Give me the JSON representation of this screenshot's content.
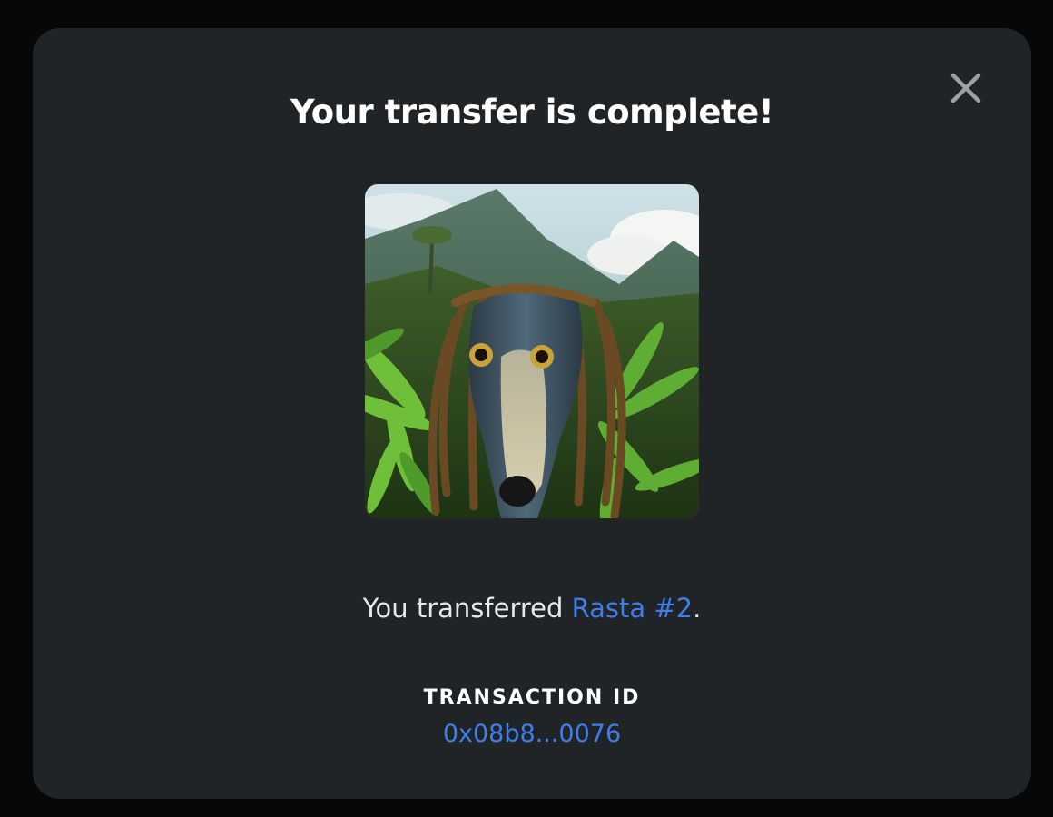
{
  "modal": {
    "title": "Your transfer is complete!",
    "close_icon": "close-icon"
  },
  "nft": {
    "image_subject": "dog-with-dreadlocks-in-jungle",
    "name": "Rasta #2"
  },
  "message": {
    "prefix": "You transferred ",
    "suffix": "."
  },
  "transaction": {
    "label": "TRANSACTION ID",
    "id": "0x08b8...0076"
  },
  "colors": {
    "backdrop": "#060708",
    "modal_background": "#212427",
    "link": "#3e7ee8",
    "close_icon": "#9aa0a6"
  }
}
